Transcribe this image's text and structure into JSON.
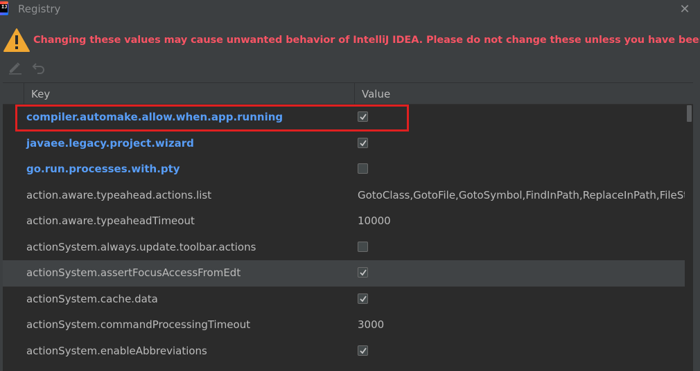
{
  "window": {
    "title": "Registry",
    "icon_text": "IJ"
  },
  "warning": {
    "text": "Changing these values may cause unwanted behavior of IntelliJ IDEA. Please do not change these unless you have been asked.",
    "color": "#f75464"
  },
  "toolbar": {
    "edit_icon": "edit-pencil-icon",
    "revert_icon": "undo-icon"
  },
  "table": {
    "columns": [
      "Key",
      "Value"
    ],
    "rows": [
      {
        "key": "compiler.automake.allow.when.app.running",
        "type": "checkbox",
        "checked": true,
        "modified": true
      },
      {
        "key": "javaee.legacy.project.wizard",
        "type": "checkbox",
        "checked": true,
        "modified": true
      },
      {
        "key": "go.run.processes.with.pty",
        "type": "checkbox",
        "checked": false,
        "modified": true
      },
      {
        "key": "action.aware.typeahead.actions.list",
        "type": "text",
        "value": "GotoClass,GotoFile,GotoSymbol,FindInPath,ReplaceInPath,FileStr",
        "modified": false
      },
      {
        "key": "action.aware.typeaheadTimeout",
        "type": "text",
        "value": "10000",
        "modified": false
      },
      {
        "key": "actionSystem.always.update.toolbar.actions",
        "type": "checkbox",
        "checked": false,
        "modified": false
      },
      {
        "key": "actionSystem.assertFocusAccessFromEdt",
        "type": "checkbox",
        "checked": true,
        "modified": false,
        "hover": true
      },
      {
        "key": "actionSystem.cache.data",
        "type": "checkbox",
        "checked": true,
        "modified": false
      },
      {
        "key": "actionSystem.commandProcessingTimeout",
        "type": "text",
        "value": "3000",
        "modified": false
      },
      {
        "key": "actionSystem.enableAbbreviations",
        "type": "checkbox",
        "checked": true,
        "modified": false
      }
    ]
  },
  "colors": {
    "background": "#3c3f41",
    "table_bg": "#2b2b2b",
    "modified_key": "#589df6",
    "highlight_border": "#e02020"
  }
}
